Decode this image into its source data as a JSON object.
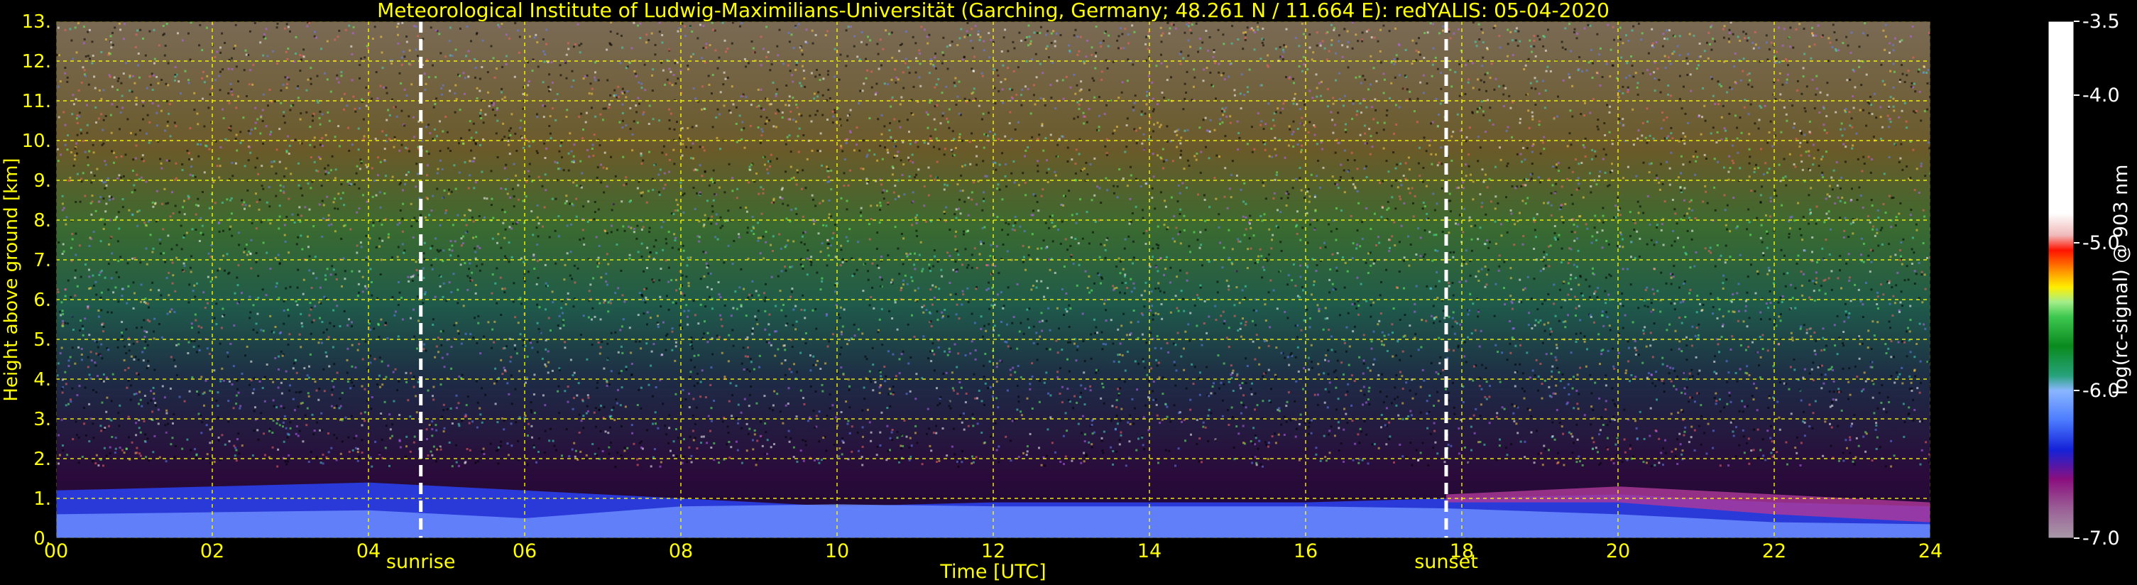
{
  "chart_data": {
    "type": "heatmap",
    "title": "Meteorological Institute of Ludwig-Maximilians-Universität (Garching, Germany; 48.261 N / 11.664 E):    redYALIS: 05-04-2020",
    "xlabel": "Time [UTC]",
    "ylabel": "Height above ground [km]",
    "xlim": [
      0,
      24
    ],
    "ylim": [
      0,
      13
    ],
    "x_ticks": [
      "00",
      "02",
      "04",
      "06",
      "08",
      "10",
      "12",
      "14",
      "16",
      "18",
      "20",
      "22",
      "24"
    ],
    "x_tick_values": [
      0,
      2,
      4,
      6,
      8,
      10,
      12,
      14,
      16,
      18,
      20,
      22,
      24
    ],
    "y_ticks": [
      "0.",
      "1.",
      "2.",
      "3.",
      "4.",
      "5.",
      "6.",
      "7.",
      "8.",
      "9.",
      "10.",
      "11.",
      "12.",
      "13."
    ],
    "y_tick_values": [
      0,
      1,
      2,
      3,
      4,
      5,
      6,
      7,
      8,
      9,
      10,
      11,
      12,
      13
    ],
    "grid": true,
    "annotations": [
      {
        "label": "sunrise",
        "x": 4.67
      },
      {
        "label": "sunset",
        "x": 17.8
      }
    ],
    "colorbar": {
      "label": "log(rc-signal) @ 903 nm",
      "range": [
        -7.0,
        -3.5
      ],
      "ticks": [
        "-3.5",
        "-4.0",
        "-5.0",
        "-6.0",
        "-7.0"
      ],
      "tick_values": [
        -3.5,
        -4.0,
        -5.0,
        -6.0,
        -7.0
      ],
      "stops": [
        {
          "v": -7.0,
          "color": "#a89aa8"
        },
        {
          "v": -6.8,
          "color": "#9a5f96"
        },
        {
          "v": -6.6,
          "color": "#8a0f7e"
        },
        {
          "v": -6.4,
          "color": "#1422d8"
        },
        {
          "v": -6.2,
          "color": "#4c7cff"
        },
        {
          "v": -6.0,
          "color": "#8ab6ff"
        },
        {
          "v": -5.9,
          "color": "#27a27c"
        },
        {
          "v": -5.7,
          "color": "#0a8a1e"
        },
        {
          "v": -5.5,
          "color": "#3ec850"
        },
        {
          "v": -5.4,
          "color": "#a4ee8a"
        },
        {
          "v": -5.3,
          "color": "#ffee00"
        },
        {
          "v": -5.2,
          "color": "#ff9a00"
        },
        {
          "v": -5.05,
          "color": "#ff1200"
        },
        {
          "v": -4.95,
          "color": "#f0b8b8"
        },
        {
          "v": -4.8,
          "color": "#ffffff"
        },
        {
          "v": -3.5,
          "color": "#ffffff"
        }
      ]
    },
    "background_color": "#000000",
    "text_color": "#ffff00",
    "grid_color": "#ffff00",
    "marker_color": "#ffffff"
  }
}
